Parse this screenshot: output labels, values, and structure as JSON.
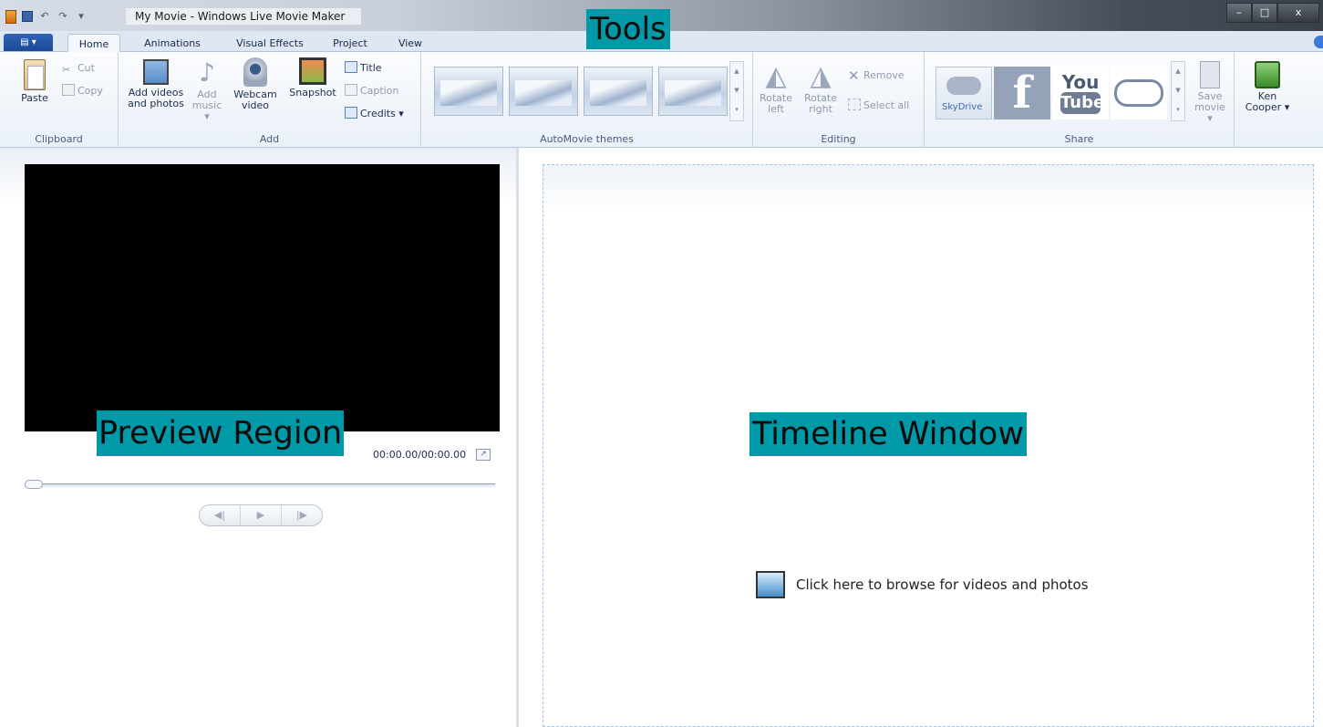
{
  "window": {
    "title": "My Movie - Windows Live Movie Maker",
    "controls": {
      "minimize": "–",
      "maximize": "□",
      "close": "x"
    }
  },
  "annotations": {
    "tools": "Tools",
    "preview": "Preview Region",
    "timeline": "Timeline Window"
  },
  "tabs": [
    {
      "label": "Home",
      "active": true
    },
    {
      "label": "Animations"
    },
    {
      "label": "Visual Effects"
    },
    {
      "label": "Project"
    },
    {
      "label": "View"
    }
  ],
  "ribbon": {
    "clipboard": {
      "label": "Clipboard",
      "paste": "Paste",
      "cut": "Cut",
      "copy": "Copy"
    },
    "add": {
      "label": "Add",
      "add_videos_line1": "Add videos",
      "add_videos_line2": "and photos",
      "add_music_line1": "Add",
      "add_music_line2": "music ▾",
      "webcam_line1": "Webcam",
      "webcam_line2": "video",
      "snapshot": "Snapshot",
      "title": "Title",
      "caption": "Caption",
      "credits": "Credits ▾"
    },
    "themes": {
      "label": "AutoMovie themes"
    },
    "editing": {
      "label": "Editing",
      "rotate_left_line1": "Rotate",
      "rotate_left_line2": "left",
      "rotate_right_line1": "Rotate",
      "rotate_right_line2": "right",
      "remove": "Remove",
      "select_all": "Select all"
    },
    "share": {
      "label": "Share",
      "skydrive": "SkyDrive",
      "youtube_top": "You",
      "youtube_bottom": "Tube",
      "save_movie_line1": "Save",
      "save_movie_line2": "movie ▾"
    },
    "user": {
      "name_line1": "Ken",
      "name_line2": "Cooper ▾"
    }
  },
  "preview": {
    "timecode": "00:00.00/00:00.00"
  },
  "timeline": {
    "browse_text": "Click here to browse for videos and photos"
  }
}
